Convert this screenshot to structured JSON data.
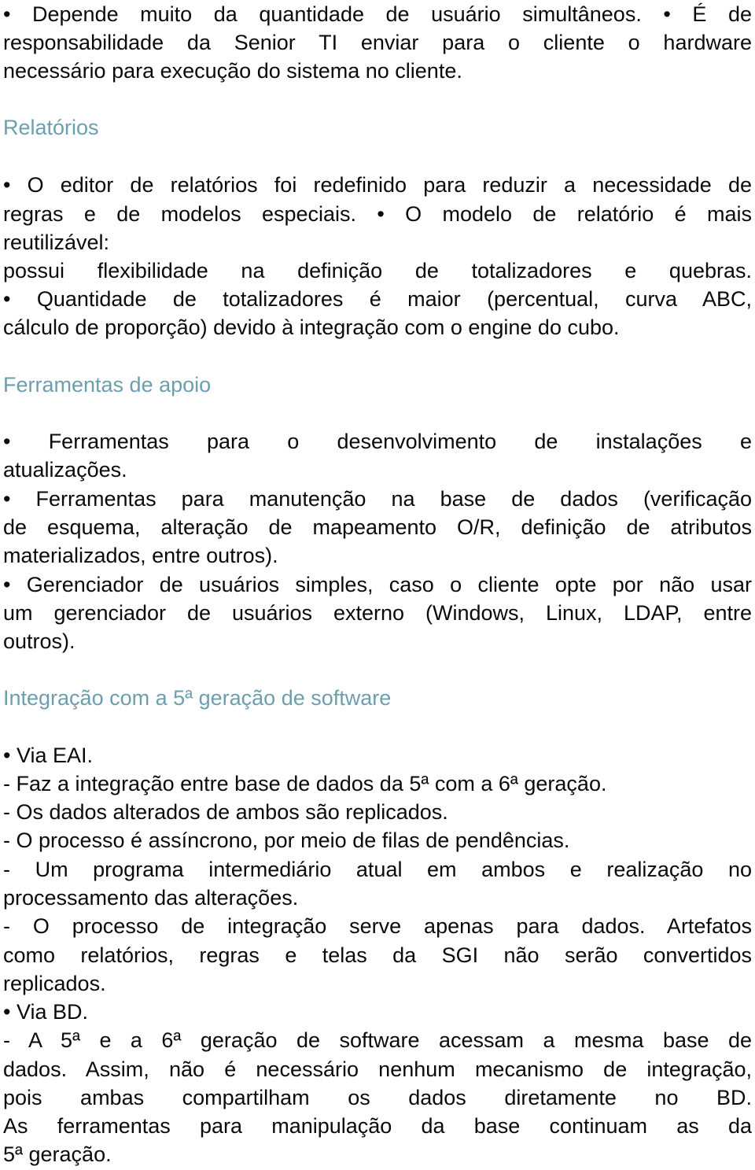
{
  "document": {
    "intro": {
      "lines": [
        "• Depende muito da quantidade de usuário simultâneos. • É de",
        "responsabilidade da Senior TI enviar para o cliente o hardware",
        "necessário para execução do sistema no cliente."
      ]
    },
    "sections": [
      {
        "heading": "Relatórios",
        "lines": [
          "• O editor de relatórios foi redefinido para reduzir a necessidade de",
          "regras e de modelos especiais. • O modelo de relatório é mais",
          "reutilizável:",
          "possui flexibilidade na definição de totalizadores e quebras.",
          "• Quantidade de totalizadores é maior (percentual, curva ABC,",
          "cálculo de proporção) devido à integração com o engine do cubo."
        ]
      },
      {
        "heading": "Ferramentas de apoio",
        "lines": [
          "• Ferramentas para o desenvolvimento de instalações e",
          "atualizações.",
          "• Ferramentas para manutenção na base de dados (verificação",
          "de esquema, alteração de mapeamento O/R, definição de atributos",
          "materializados, entre outros).",
          "• Gerenciador de usuários simples, caso o cliente opte por não usar",
          "um gerenciador de usuários externo (Windows, Linux, LDAP, entre",
          "outros)."
        ]
      },
      {
        "heading": "Integração com a 5ª geração de software",
        "lines": [
          "• Via EAI.",
          "- Faz a integração entre base de dados da 5ª com a 6ª geração.",
          "- Os dados alterados de ambos são replicados.",
          "- O processo é assíncrono, por meio de filas de pendências.",
          "- Um programa intermediário atual em ambos e realização no",
          "processamento das alterações.",
          "- O processo de integração serve apenas para dados. Artefatos",
          "como relatórios, regras e telas da SGI não serão convertidos",
          "replicados.",
          "• Via BD.",
          "- A 5ª e a 6ª geração de software acessam a mesma base de",
          "dados. Assim, não é necessário nenhum mecanismo de integração,",
          "pois ambas compartilham os dados diretamente no BD.",
          " As ferramentas para manipulação da base continuam as da",
          "5ª geração."
        ]
      }
    ],
    "colors": {
      "heading": "#6d9eae",
      "body_text": "#0a0a0a",
      "background": "#ffffff"
    }
  }
}
